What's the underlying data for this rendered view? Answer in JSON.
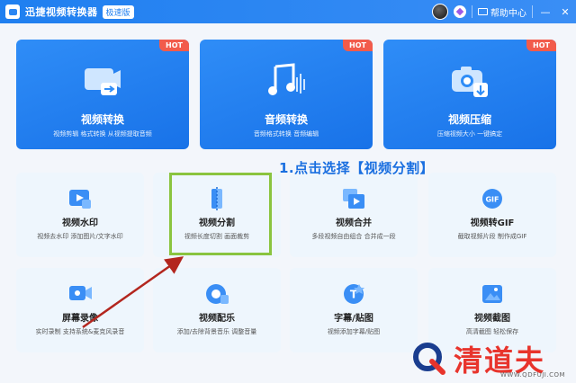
{
  "app": {
    "title": "迅捷视频转换器",
    "edition": "极速版",
    "help_label": "帮助中心",
    "minimize": "—",
    "close": "✕"
  },
  "top_cards": [
    {
      "title": "视频转换",
      "desc": "视频剪辑  格式转换  从视频提取音频",
      "badge": "HOT",
      "icon": "video-convert-icon"
    },
    {
      "title": "音频转换",
      "desc": "音频格式转换  音频编辑",
      "badge": "HOT",
      "icon": "music-note-icon"
    },
    {
      "title": "视频压缩",
      "desc": "压缩视频大小  一键搞定",
      "badge": "HOT",
      "icon": "compress-camera-icon"
    }
  ],
  "tools": [
    {
      "title": "视频水印",
      "desc": "视频去水印  添加图片/文字水印",
      "icon": "watermark-icon"
    },
    {
      "title": "视频分割",
      "desc": "视频长度切割  画面裁剪",
      "icon": "split-icon"
    },
    {
      "title": "视频合并",
      "desc": "多段视频自由组合  合并成一段",
      "icon": "merge-icon"
    },
    {
      "title": "视频转GIF",
      "desc": "截取视频片段  制作成GIF",
      "icon": "gif-icon"
    },
    {
      "title": "屏幕录像",
      "desc": "实时录制  支持系统&麦克风录音",
      "icon": "screen-record-icon"
    },
    {
      "title": "视频配乐",
      "desc": "添加/去除背景音乐  调整音量",
      "icon": "music-add-icon"
    },
    {
      "title": "字幕/贴图",
      "desc": "视频添加字幕/贴图",
      "icon": "subtitle-icon"
    },
    {
      "title": "视频截图",
      "desc": "高清截图  轻松保存",
      "icon": "screenshot-icon"
    }
  ],
  "annotation": "1.点击选择【视频分割】",
  "watermark": {
    "text": "清道夫",
    "url": "WWW.QDFUJI.COM"
  },
  "colors": {
    "primary": "#1f7ff0",
    "hot": "#f25b4b",
    "highlight": "#8ac43f",
    "arrow": "#b3261e",
    "watermark": "#e8342c"
  }
}
